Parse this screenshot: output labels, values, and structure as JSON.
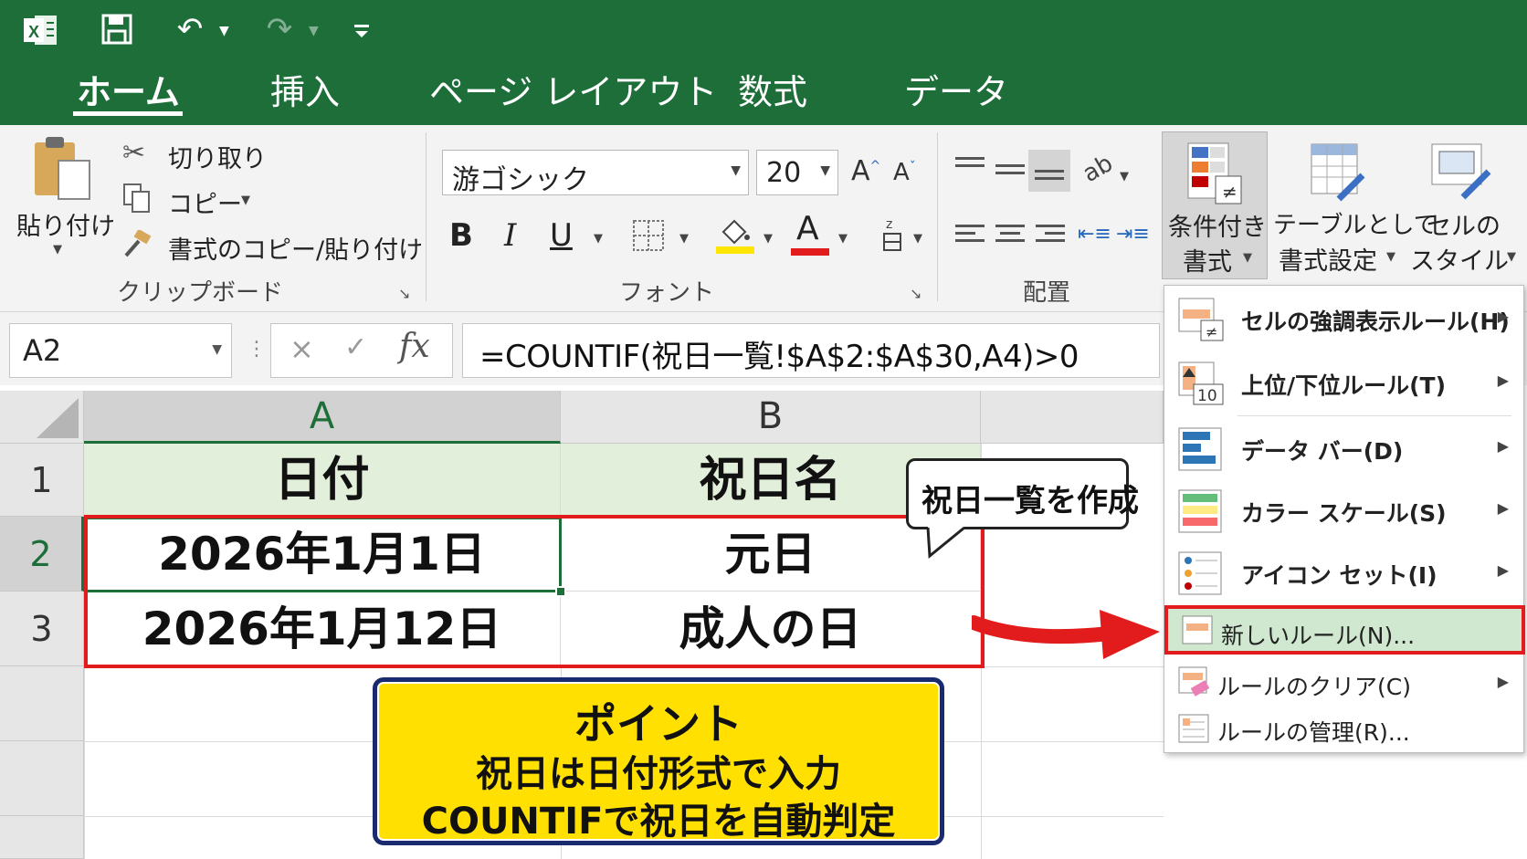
{
  "tabs": [
    "ホーム",
    "挿入",
    "ページ レイアウト",
    "数式",
    "データ"
  ],
  "clipboard": {
    "paste": "貼り付け",
    "cut": "切り取り",
    "copy": "コピー",
    "format_painter": "書式のコピー/貼り付け",
    "group": "クリップボード"
  },
  "font": {
    "name": "游ゴシック",
    "size": "20",
    "grow": "A",
    "shrink": "A",
    "bold": "B",
    "italic": "I",
    "underline": "U",
    "color_letter": "A",
    "group": "フォント",
    "highlight_color": "#ffe600",
    "font_color": "#e21c1c"
  },
  "alignment": {
    "group": "配置"
  },
  "styles": {
    "cond_l1": "条件付き",
    "cond_l2": "書式",
    "table_l1": "テーブルとして",
    "table_l2": "書式設定",
    "cell_l1": "セルの",
    "cell_l2": "スタイル"
  },
  "formula_bar": {
    "name_box": "A2",
    "cancel": "×",
    "enter": "✓",
    "fx": "fx",
    "formula": "=COUNTIF(祝日一覧!$A$2:$A$30,A4)>0"
  },
  "sheet": {
    "columns": [
      "A",
      "B"
    ],
    "rows": [
      "1",
      "2",
      "3"
    ],
    "header": [
      "日付",
      "祝日名"
    ],
    "data": [
      [
        "2026年1月1日",
        "元日"
      ],
      [
        "2026年1月12日",
        "成人の日"
      ]
    ]
  },
  "callout": "祝日一覧を作成",
  "point_box": {
    "title": "ポイント",
    "line1": "祝日は日付形式で入力",
    "line2": "COUNTIFで祝日を自動判定"
  },
  "menu": {
    "items": [
      "セルの強調表示ルール(H)",
      "上位/下位ルール(T)",
      "データ バー(D)",
      "カラー スケール(S)",
      "アイコン セット(I)",
      "新しいルール(N)...",
      "ルールのクリア(C)",
      "ルールの管理(R)..."
    ],
    "top_bottom_icon_number": "10"
  },
  "colors": {
    "excel_green": "#1e6e3a",
    "highlight_red": "#e21c1c",
    "point_yellow": "#ffe000",
    "point_border": "#1a2a6e",
    "menu_highlight": "#cfe8cf"
  }
}
